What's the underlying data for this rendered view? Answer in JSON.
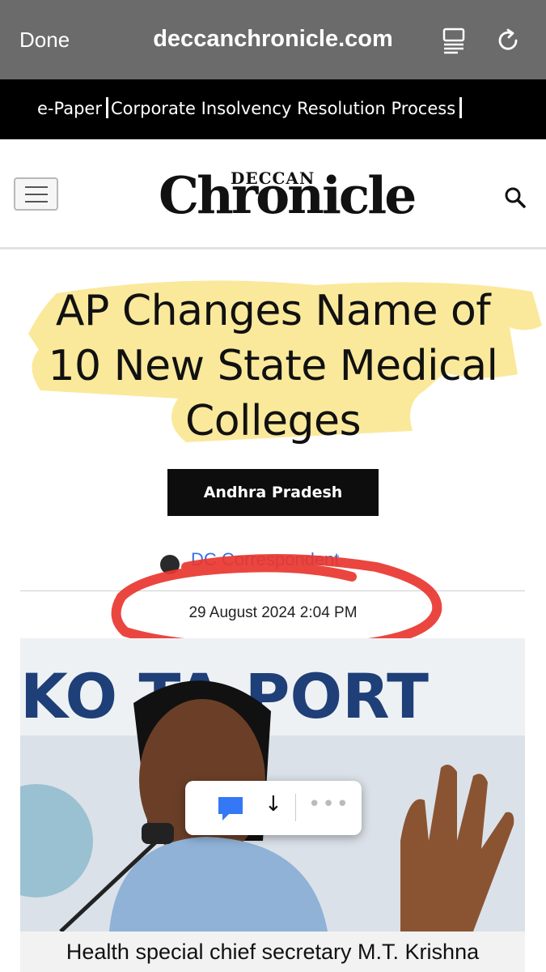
{
  "browser": {
    "done_label": "Done",
    "url": "deccanchronicle.com",
    "reader_icon": "reader-view-icon",
    "reload_icon": "reload-icon"
  },
  "ticker": {
    "items": [
      "e-Paper",
      "Corporate Insolvency Resolution Process"
    ]
  },
  "header": {
    "logo_top": "DECCAN",
    "logo_main": "Chronicle",
    "menu_icon": "hamburger-menu-icon",
    "search_icon": "search-icon"
  },
  "article": {
    "headline_lines": [
      "AP Changes Name of",
      "10 New State Medical",
      "Colleges"
    ],
    "category": "Andhra Pradesh",
    "author": "DC Correspondent",
    "date": "29 August 2024 2:04 PM",
    "photo_sign_text": "KO  TA PORT",
    "caption": "Health special chief secretary M.T. Krishna"
  },
  "popover": {
    "comment_icon": "comment-icon",
    "download_arrow": "↓",
    "more": "•••"
  },
  "colors": {
    "browser_bar": "#6b6b6b",
    "highlight": "#f8e27a",
    "red_annotation": "#e8362f",
    "author_link": "#3b6fe0",
    "comment_icon": "#3478f6"
  }
}
